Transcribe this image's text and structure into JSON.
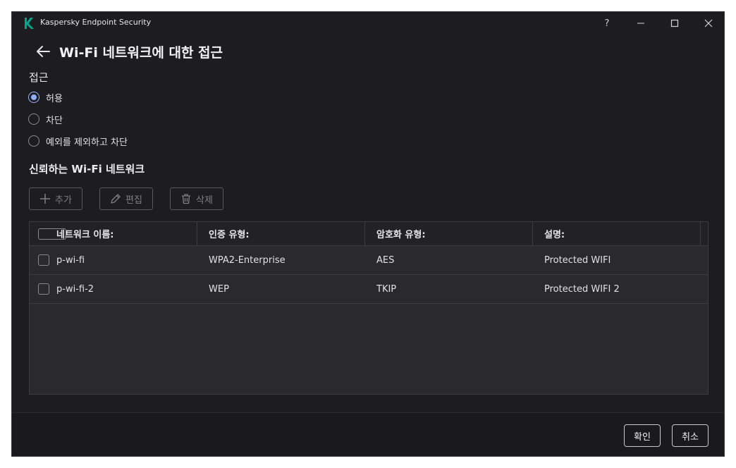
{
  "window": {
    "app_title": "Kaspersky Endpoint Security",
    "help_label": "?"
  },
  "page": {
    "title": "Wi-Fi 네트워크에 대한 접근"
  },
  "access": {
    "title": "접근",
    "options": [
      {
        "label": "허용",
        "selected": true
      },
      {
        "label": "차단",
        "selected": false
      },
      {
        "label": "예외를 제외하고 차단",
        "selected": false
      }
    ]
  },
  "trusted": {
    "title": "신뢰하는 Wi-Fi 네트워크",
    "toolbar": {
      "add_label": "추가",
      "edit_label": "편집",
      "delete_label": "삭제"
    },
    "columns": [
      "네트워크 이름:",
      "인증 유형:",
      "암호화 유형:",
      "설명:"
    ],
    "rows": [
      {
        "name": "p-wi-fi",
        "auth": "WPA2-Enterprise",
        "encryption": "AES",
        "description": "Protected WIFI"
      },
      {
        "name": "p-wi-fi-2",
        "auth": "WEP",
        "encryption": "TKIP",
        "description": "Protected WIFI 2"
      }
    ]
  },
  "footer": {
    "ok_label": "확인",
    "cancel_label": "취소"
  },
  "colors": {
    "accent": "#8fb0ff",
    "logo": "#00a88e",
    "background": "#1d1d1f"
  }
}
